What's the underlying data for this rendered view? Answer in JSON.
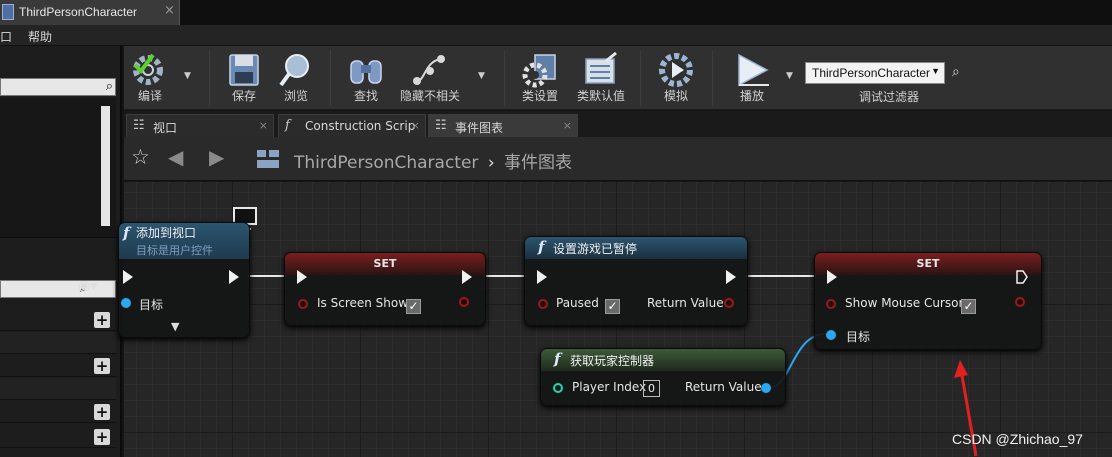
{
  "window": {
    "tab_title": "ThirdPersonCharacter",
    "close": "×"
  },
  "menu": {
    "items": [
      "口",
      "帮助"
    ]
  },
  "toolbar": {
    "buttons": [
      {
        "label": "编译",
        "icon": "compile-icon"
      },
      {
        "label": "保存",
        "icon": "save-icon"
      },
      {
        "label": "浏览",
        "icon": "browse-icon"
      },
      {
        "label": "查找",
        "icon": "find-icon"
      },
      {
        "label": "隐藏不相关",
        "icon": "hide-unrelated-icon"
      },
      {
        "label": "类设置",
        "icon": "class-settings-icon"
      },
      {
        "label": "类默认值",
        "icon": "class-defaults-icon"
      },
      {
        "label": "模拟",
        "icon": "simulate-icon"
      },
      {
        "label": "播放",
        "icon": "play-icon"
      }
    ],
    "debug_filter": {
      "selected": "ThirdPersonCharacter",
      "label": "调试过滤器"
    }
  },
  "doc_tabs": [
    {
      "label": "视口",
      "icon": "viewport-icon"
    },
    {
      "label": "Construction Scrip",
      "icon": "function-icon"
    },
    {
      "label": "事件图表",
      "icon": "event-graph-icon",
      "active": true
    }
  ],
  "breadcrumb": {
    "root": "ThirdPersonCharacter",
    "separator": "›",
    "current": "事件图表"
  },
  "graph": {
    "nodes": {
      "add_to_viewport": {
        "title": "添加到视口",
        "subtitle": "目标是用户控件",
        "target_pin": "目标"
      },
      "set_screen_show": {
        "title": "SET",
        "pin": "Is Screen Show",
        "checked": true
      },
      "set_game_paused": {
        "title": "设置游戏已暂停",
        "pin": "Paused",
        "checked": true,
        "return": "Return Value"
      },
      "set_mouse_cursor": {
        "title": "SET",
        "pin": "Show Mouse Cursor",
        "checked": true,
        "target_pin": "目标"
      },
      "get_player_controller": {
        "title": "获取玩家控制器",
        "input_pin": "Player Index",
        "input_value": "0",
        "return": "Return Value"
      }
    },
    "colors": {
      "set_header": "#7a1e1e",
      "function_header": "#2c5570",
      "pure_header": "#3d5a38",
      "object_pin": "#2aa8f0",
      "bool_pin": "#a01818",
      "int_pin": "#1fd4b4"
    }
  },
  "watermark": "CSDN @Zhichao_97"
}
